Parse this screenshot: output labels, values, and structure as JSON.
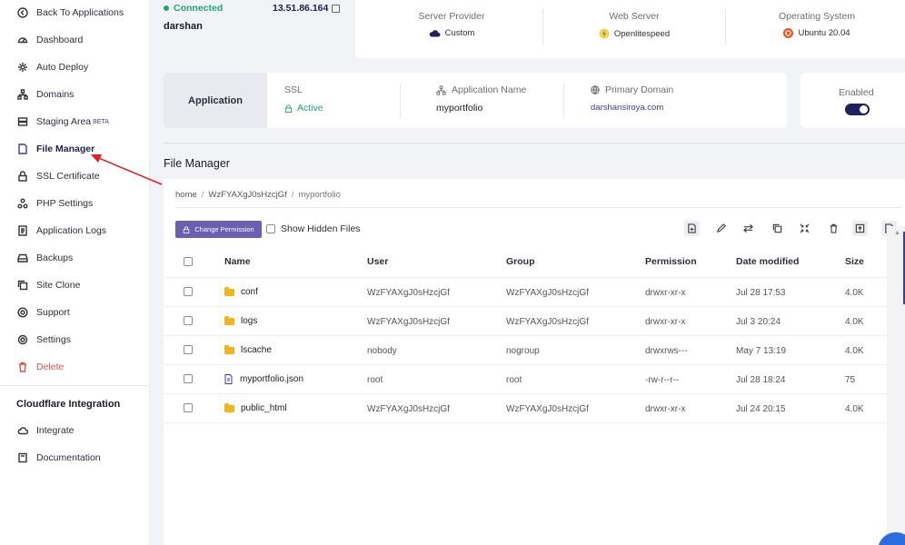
{
  "sidebar": {
    "items": [
      {
        "label": "Back To Applications",
        "icon": "arrow-left-circle-icon"
      },
      {
        "label": "Dashboard",
        "icon": "gauge-icon"
      },
      {
        "label": "Auto Deploy",
        "icon": "gear-icon"
      },
      {
        "label": "Domains",
        "icon": "network-icon"
      },
      {
        "label": "Staging Area",
        "badge": "BETA",
        "icon": "server-icon"
      },
      {
        "label": "File Manager",
        "icon": "file-icon"
      },
      {
        "label": "SSL Certificate",
        "icon": "lock-icon"
      },
      {
        "label": "PHP Settings",
        "icon": "nodes-icon"
      },
      {
        "label": "Application Logs",
        "icon": "document-icon"
      },
      {
        "label": "Backups",
        "icon": "hard-drive-icon"
      },
      {
        "label": "Site Clone",
        "icon": "copy-icon"
      },
      {
        "label": "Support",
        "icon": "lifebuoy-icon"
      },
      {
        "label": "Settings",
        "icon": "settings-icon"
      },
      {
        "label": "Delete",
        "icon": "trash-icon"
      }
    ],
    "cloudflare_heading": "Cloudflare Integration",
    "cloudflare_items": [
      {
        "label": "Integrate",
        "icon": "cloud-icon"
      },
      {
        "label": "Documentation",
        "icon": "book-icon"
      }
    ]
  },
  "server": {
    "status": "Connected",
    "ip": "13.51.86.164",
    "name": "darshan",
    "provider_label": "Server Provider",
    "provider_value": "Custom",
    "webserver_label": "Web Server",
    "webserver_value": "Openlitespeed",
    "os_label": "Operating System",
    "os_value": "Ubuntu 20.04"
  },
  "application": {
    "tab_label": "Application",
    "ssl_label": "SSL",
    "ssl_value": "Active",
    "name_label": "Application Name",
    "name_value": "myportfolio",
    "domain_label": "Primary Domain",
    "domain_value": "darshansiroya.com",
    "enabled_label": "Enabled",
    "enabled": true
  },
  "file_manager": {
    "title": "File Manager",
    "breadcrumb": [
      "home",
      "WzFYAXgJ0sHzcjGf",
      "myportfolio"
    ],
    "change_permission_label": "Change Permission",
    "show_hidden_label": "Show Hidden Files",
    "toolbar_icons": [
      "new-file-icon",
      "edit-icon",
      "move-icon",
      "copy-icon",
      "compress-icon",
      "delete-icon",
      "upload-icon",
      "download-icon"
    ],
    "columns": [
      "Name",
      "User",
      "Group",
      "Permission",
      "Date modified",
      "Size"
    ],
    "rows": [
      {
        "type": "folder",
        "name": "conf",
        "user": "WzFYAXgJ0sHzcjGf",
        "group": "WzFYAXgJ0sHzcjGf",
        "permission": "drwxr-xr-x",
        "modified": "Jul 28 17:53",
        "size": "4.0K"
      },
      {
        "type": "folder",
        "name": "logs",
        "user": "WzFYAXgJ0sHzcjGf",
        "group": "WzFYAXgJ0sHzcjGf",
        "permission": "drwxr-xr-x",
        "modified": "Jul 3 20:24",
        "size": "4.0K"
      },
      {
        "type": "folder",
        "name": "lscache",
        "user": "nobody",
        "group": "nogroup",
        "permission": "drwxrws---",
        "modified": "May 7 13:19",
        "size": "4.0K"
      },
      {
        "type": "file",
        "name": "myportfolio.json",
        "user": "root",
        "group": "root",
        "permission": "-rw-r--r--",
        "modified": "Jul 28 18:24",
        "size": "75"
      },
      {
        "type": "folder",
        "name": "public_html",
        "user": "WzFYAXgJ0sHzcjGf",
        "group": "WzFYAXgJ0sHzcjGf",
        "permission": "drwxr-xr-x",
        "modified": "Jul 24 20:15",
        "size": "4.0K"
      }
    ]
  },
  "colors": {
    "accent": "#3b3ba0",
    "success": "#20a66d",
    "danger": "#e0524f",
    "folder": "#f2b41c",
    "button": "#6a5fb0",
    "annotation_arrow": "#e02020"
  }
}
